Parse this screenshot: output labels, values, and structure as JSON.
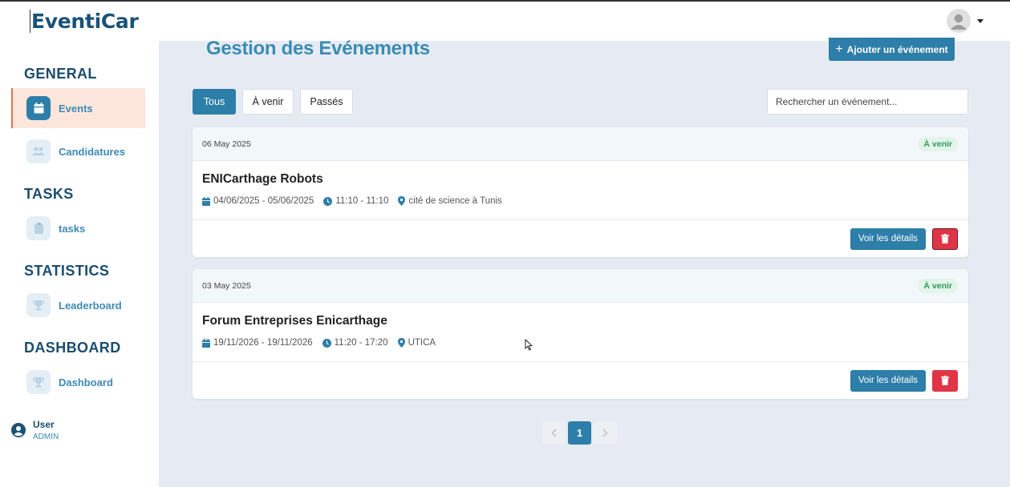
{
  "app": {
    "title": "EventiCar"
  },
  "sidebar": {
    "sections": [
      {
        "title": "GENERAL",
        "items": [
          {
            "label": "Events",
            "icon": "calendar-icon",
            "active": true
          },
          {
            "label": "Candidatures",
            "icon": "users-icon",
            "active": false
          }
        ]
      },
      {
        "title": "TASKS",
        "items": [
          {
            "label": "tasks",
            "icon": "clipboard-icon",
            "active": false
          }
        ]
      },
      {
        "title": "STATISTICS",
        "items": [
          {
            "label": "Leaderboard",
            "icon": "trophy-icon",
            "active": false
          }
        ]
      },
      {
        "title": "DASHBOARD",
        "items": [
          {
            "label": "Dashboard",
            "icon": "trophy-icon",
            "active": false
          }
        ]
      }
    ],
    "user": {
      "name": "User",
      "role": "ADMIN"
    }
  },
  "main": {
    "title": "Gestion des Evénements",
    "add_button_label": "Ajouter un événement",
    "filters": [
      "Tous",
      "À venir",
      "Passés"
    ],
    "active_filter": "Tous",
    "search": {
      "placeholder": "Rechercher un événement...",
      "value": ""
    },
    "events": [
      {
        "created": "06 May 2025",
        "status": "À venir",
        "title": "ENICarthage Robots",
        "dates": "04/06/2025 - 05/06/2025",
        "time": "11:10 - 11:10",
        "location": "cité de science à Tunis",
        "details_label": "Voir les détails"
      },
      {
        "created": "03 May 2025",
        "status": "À venir",
        "title": "Forum Entreprises Enicarthage",
        "dates": "19/11/2026 - 19/11/2026",
        "time": "11:20 - 17:20",
        "location": "UTICA",
        "details_label": "Voir les détails"
      }
    ],
    "pagination": {
      "current_page": "1"
    }
  },
  "colors": {
    "primary": "#2d7ea8",
    "title": "#3a8cb5",
    "danger": "#e03546",
    "badge_bg": "#e3f4ea",
    "badge_text": "#2e9a5a",
    "active_nav_bg": "#fde6dc",
    "active_nav_border": "#e0754e",
    "background": "#e6ebf3"
  }
}
